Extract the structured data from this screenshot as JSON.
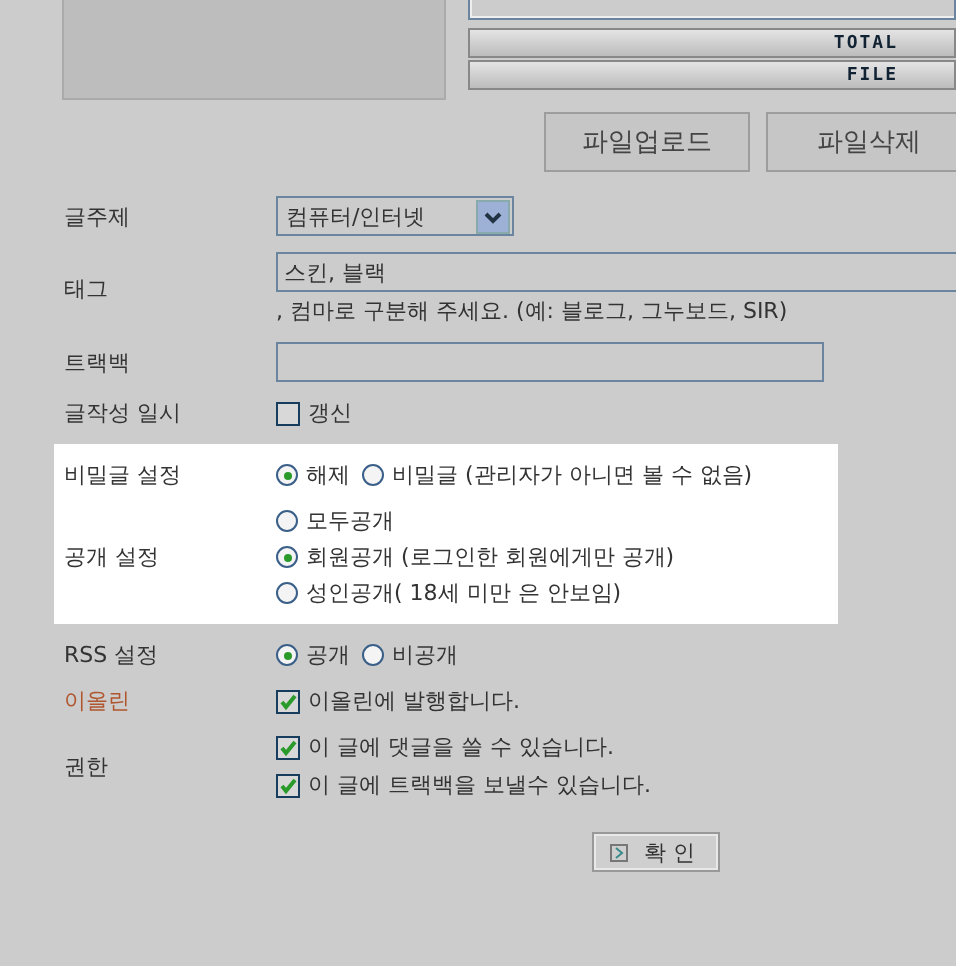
{
  "file_panel": {
    "total_label": "TOTAL",
    "file_label": "FILE"
  },
  "file_buttons": [
    "파일업로드",
    "파일삭제"
  ],
  "sections": [
    {
      "highlighted": false,
      "rows": [
        {
          "kind": "select",
          "label": "글주제",
          "value": "컴퓨터/인터넷"
        },
        {
          "kind": "tags",
          "label": "태그",
          "value": "스킨, 블랙",
          "hint": ", 컴마로 구분해 주세요. (예: 블로그, 그누보드, SIR)"
        },
        {
          "kind": "text",
          "label": "트랙백"
        },
        {
          "kind": "checks",
          "label": "글작성 일시",
          "options": [
            {
              "label": "갱신",
              "checked": false
            }
          ]
        }
      ]
    },
    {
      "highlighted": true,
      "rows": [
        {
          "kind": "radio_inline",
          "label": "비밀글 설정",
          "options": [
            {
              "label": "해제",
              "selected": true
            },
            {
              "label": "비밀글 (관리자가 아니면 볼 수 없음)",
              "selected": false
            }
          ]
        },
        {
          "kind": "radio_stack",
          "label": "공개 설정",
          "options": [
            {
              "label": "모두공개",
              "selected": false
            },
            {
              "label": "회원공개 (로그인한 회원에게만 공개)",
              "selected": true
            },
            {
              "label": "성인공개( 18세 미만 은 안보임)",
              "selected": false
            }
          ]
        }
      ]
    },
    {
      "highlighted": false,
      "rows": [
        {
          "kind": "radio_inline",
          "label": "RSS 설정",
          "options": [
            {
              "label": "공개",
              "selected": true
            },
            {
              "label": "비공개",
              "selected": false
            }
          ]
        },
        {
          "kind": "checks",
          "label": "이올린",
          "color": "#b0562e",
          "options": [
            {
              "label": "이올린에 발행합니다.",
              "checked": true
            }
          ]
        },
        {
          "kind": "checks",
          "label": "권한",
          "options": [
            {
              "label": "이 글에 댓글을 쓸 수 있습니다.",
              "checked": true
            },
            {
              "label": "이 글에 트랙백을 보낼수 있습니다.",
              "checked": true
            }
          ]
        }
      ]
    }
  ],
  "submit_button": "확 인"
}
